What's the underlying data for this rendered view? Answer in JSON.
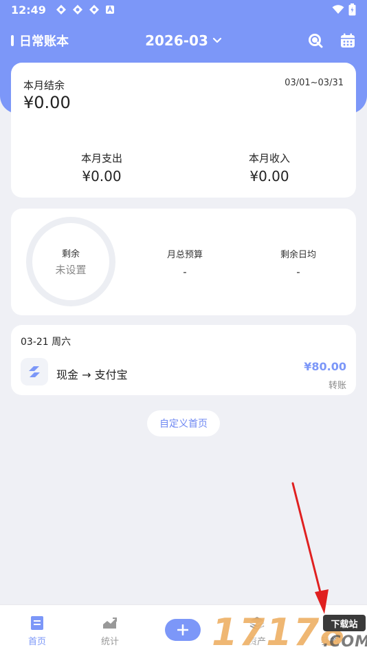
{
  "status_bar": {
    "time": "12:49"
  },
  "header": {
    "book_name": "日常账本",
    "month": "2026-03"
  },
  "summary": {
    "balance_label": "本月结余",
    "balance_value": "¥0.00",
    "date_range": "03/01~03/31",
    "expense_label": "本月支出",
    "expense_value": "¥0.00",
    "income_label": "本月收入",
    "income_value": "¥0.00"
  },
  "budget": {
    "ring_label": "剩余",
    "ring_value": "未设置",
    "total_label": "月总预算",
    "total_value": "-",
    "daily_label": "剩余日均",
    "daily_value": "-"
  },
  "transactions": [
    {
      "date": "03-21 周六",
      "name": "现金 → 支付宝",
      "amount": "¥80.00",
      "type": "转账"
    }
  ],
  "customize_label": "自定义首页",
  "tabs": [
    {
      "label": "首页",
      "icon": "home-icon"
    },
    {
      "label": "统计",
      "icon": "chart-icon"
    },
    {
      "label": "资产",
      "icon": "assets-icon"
    },
    {
      "label": "我的",
      "icon": "profile-icon"
    }
  ],
  "watermark": {
    "digits": "17178",
    "badge": "下载站",
    "suffix": ".COM"
  },
  "colors": {
    "accent": "#7c97f8",
    "background": "#eff0f5",
    "annotation_arrow": "#e02020"
  }
}
